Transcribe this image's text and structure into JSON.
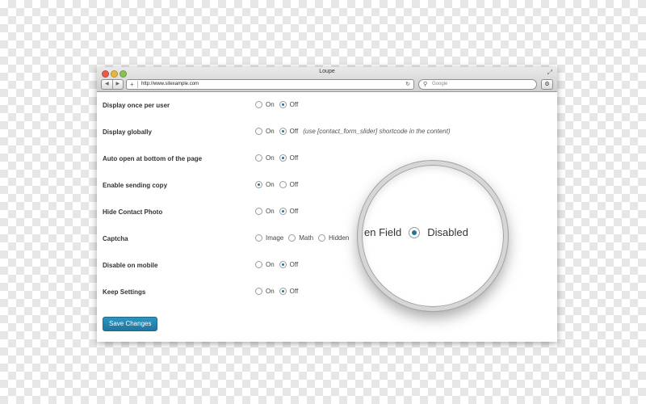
{
  "window": {
    "title": "Loupe",
    "url": "http://www.sitexample.com",
    "search_placeholder": "Google",
    "icons": {
      "back": "back-arrow-icon",
      "forward": "forward-arrow-icon",
      "add_tab": "plus-icon",
      "reload": "reload-icon",
      "search": "search-icon",
      "settings": "gear-icon",
      "resize": "resize-icon"
    }
  },
  "settings": {
    "rows": [
      {
        "label": "Display once per user",
        "options": [
          {
            "label": "On",
            "checked": false
          },
          {
            "label": "Off",
            "checked": true
          }
        ],
        "note": ""
      },
      {
        "label": "Display globally",
        "options": [
          {
            "label": "On",
            "checked": false
          },
          {
            "label": "Off",
            "checked": true
          }
        ],
        "note": "(use [contact_form_slider] shortcode in the content)"
      },
      {
        "label": "Auto open at bottom of the page",
        "options": [
          {
            "label": "On",
            "checked": false
          },
          {
            "label": "Off",
            "checked": true
          }
        ],
        "note": ""
      },
      {
        "label": "Enable sending copy",
        "options": [
          {
            "label": "On",
            "checked": true
          },
          {
            "label": "Off",
            "checked": false
          }
        ],
        "note": ""
      },
      {
        "label": "Hide Contact Photo",
        "options": [
          {
            "label": "On",
            "checked": false
          },
          {
            "label": "Off",
            "checked": true
          }
        ],
        "note": ""
      },
      {
        "label": "Captcha",
        "options": [
          {
            "label": "Image",
            "checked": false
          },
          {
            "label": "Math",
            "checked": false
          },
          {
            "label": "Hidden",
            "checked": false
          }
        ],
        "note": ""
      },
      {
        "label": "Disable on mobile",
        "options": [
          {
            "label": "On",
            "checked": false
          },
          {
            "label": "Off",
            "checked": true
          }
        ],
        "note": ""
      },
      {
        "label": "Keep Settings",
        "options": [
          {
            "label": "On",
            "checked": false
          },
          {
            "label": "Off",
            "checked": true
          }
        ],
        "note": ""
      }
    ],
    "save_label": "Save Changes"
  },
  "loupe": {
    "partial_text": "en Field",
    "selected_label": "Disabled"
  },
  "colors": {
    "accent": "#21759b",
    "button": "#2a95c5"
  }
}
